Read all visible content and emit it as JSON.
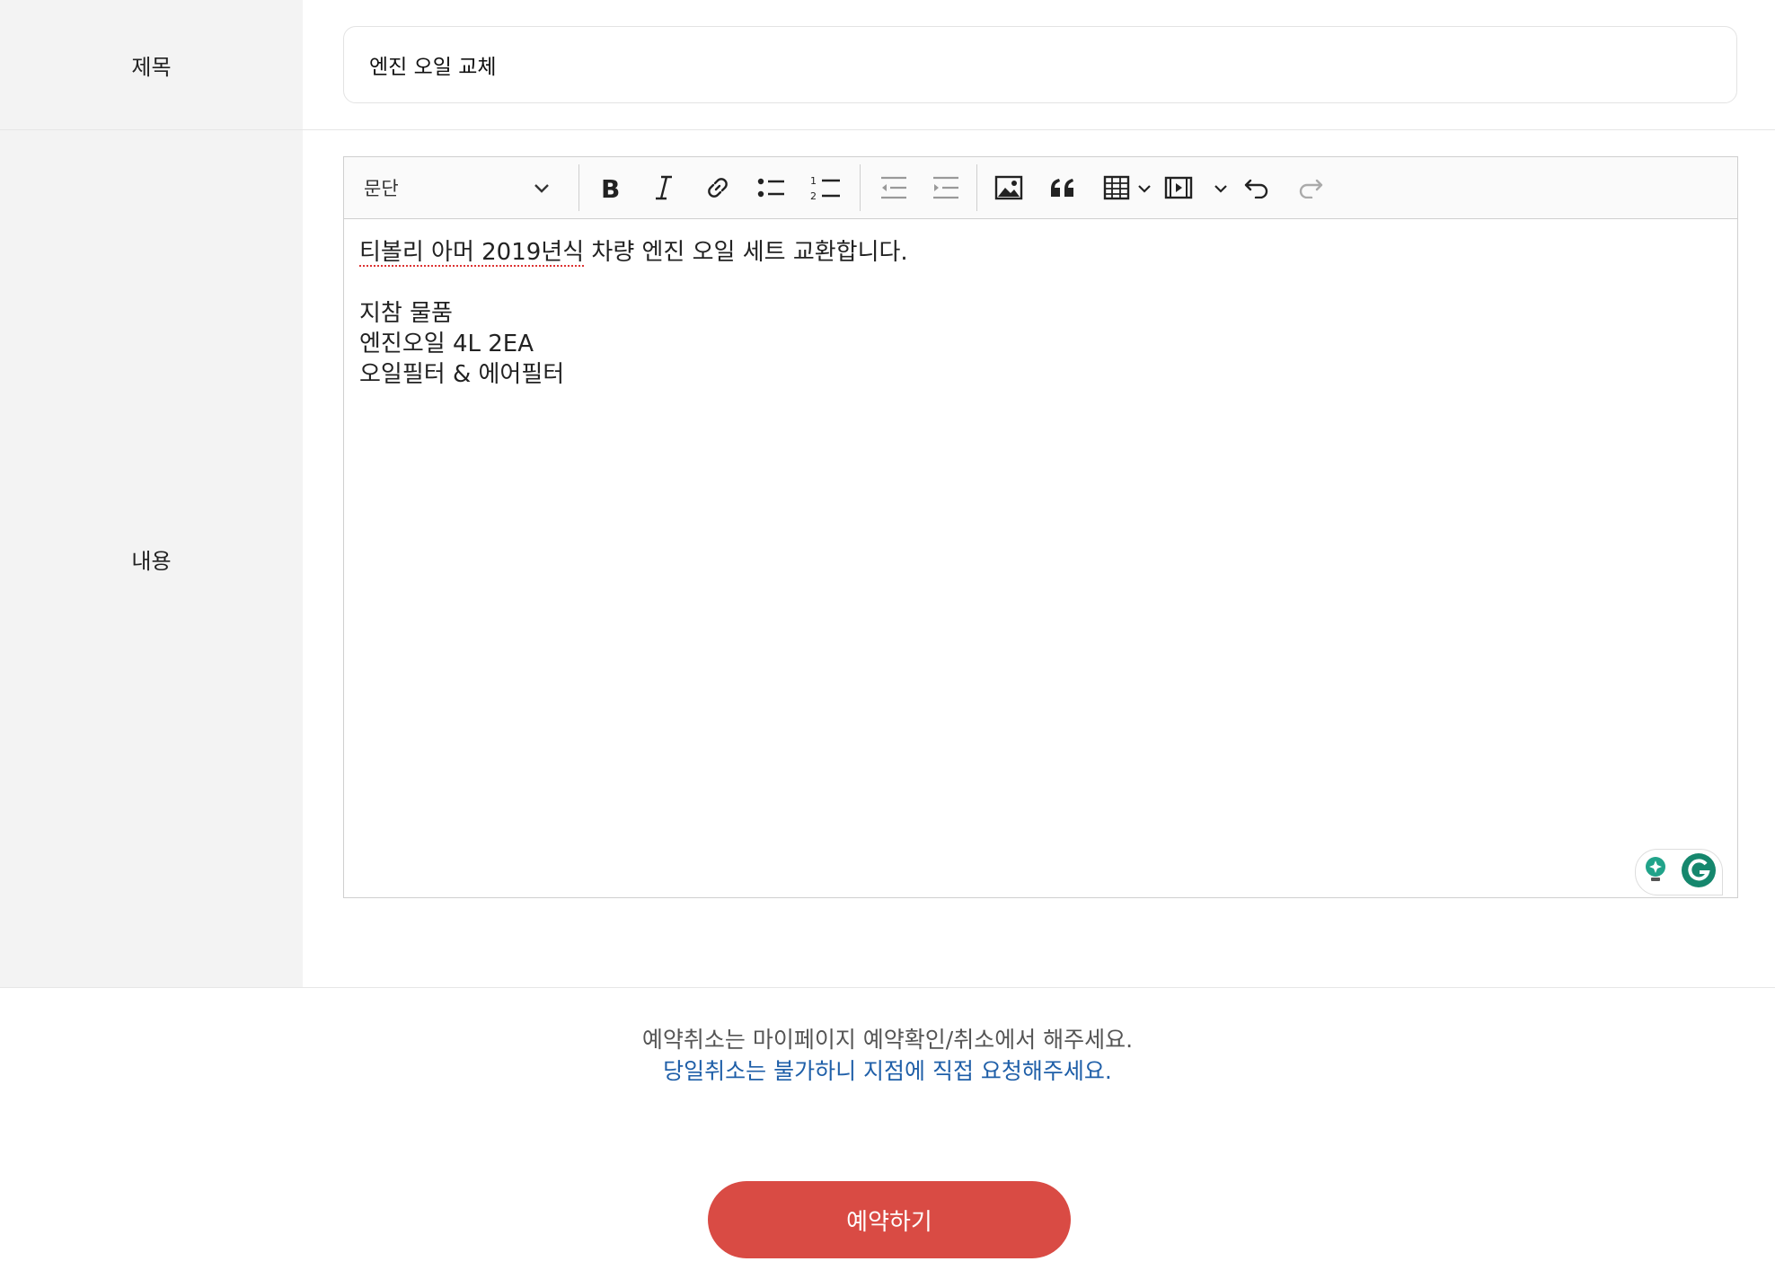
{
  "form": {
    "title_label": "제목",
    "title_value": "엔진 오일 교체",
    "content_label": "내용"
  },
  "editor": {
    "heading_select": "문단",
    "toolbar_icons": [
      "bold-icon",
      "italic-icon",
      "link-icon",
      "bulleted-list-icon",
      "numbered-list-icon",
      "outdent-icon",
      "indent-icon",
      "image-icon",
      "blockquote-icon",
      "table-icon",
      "media-icon",
      "undo-icon",
      "redo-icon"
    ],
    "lines": [
      {
        "spell": "티볼리 아머 2019년식",
        "rest": " 차량 엔진 오일 세트 교환합니다."
      },
      "",
      "지참 물품",
      "엔진오일 4L 2EA",
      "오일필터 & 에어필터"
    ]
  },
  "notice": {
    "line1": "예약취소는 마이페이지 예약확인/취소에서 해주세요.",
    "line2": "당일취소는 불가하니 지점에 직접 요청해주세요."
  },
  "submit_label": "예약하기",
  "colors": {
    "accent_button": "#d94b44",
    "notice_blue": "#1f5fa8",
    "label_bg": "#f3f3f3"
  }
}
